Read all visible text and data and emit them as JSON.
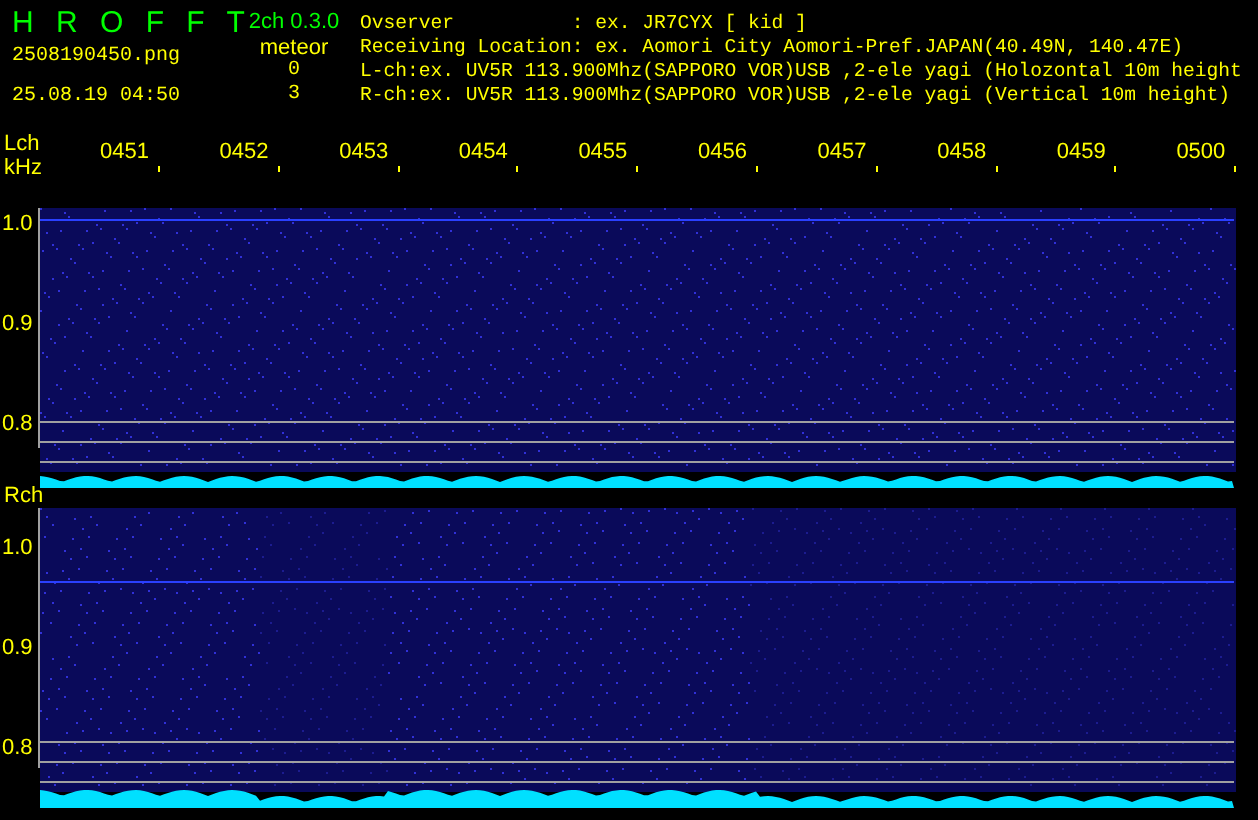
{
  "app": {
    "logo": "H R O F F T",
    "version": "2ch 0.3.0"
  },
  "file": {
    "name": "2508190450.png",
    "datetime": "25.08.19 04:50"
  },
  "meteor": {
    "label": "meteor",
    "counts": [
      "0",
      "3"
    ]
  },
  "info": [
    {
      "label": "Ovserver          ",
      "value": ": ex. JR7CYX [ kid ]"
    },
    {
      "label": "Receiving Location",
      "value": ": ex. Aomori City Aomori-Pref.JAPAN(40.49N, 140.47E)"
    },
    {
      "label": "L-ch",
      "value": ":ex. UV5R 113.900Mhz(SAPPORO VOR)USB ,2-ele yagi (Holozontal 10m height"
    },
    {
      "label": "R-ch",
      "value": ":ex. UV5R 113.900Mhz(SAPPORO VOR)USB ,2-ele yagi (Vertical 10m height)"
    }
  ],
  "time_axis": [
    "0451",
    "0452",
    "0453",
    "0454",
    "0455",
    "0456",
    "0457",
    "0458",
    "0459",
    "0500"
  ],
  "channels": [
    {
      "label": "Lch",
      "unit": "kHz",
      "ticks": [
        "1.0",
        "0.9",
        "0.8"
      ]
    },
    {
      "label": "Rch",
      "ticks": [
        "1.0",
        "0.9",
        "0.8"
      ]
    }
  ]
}
